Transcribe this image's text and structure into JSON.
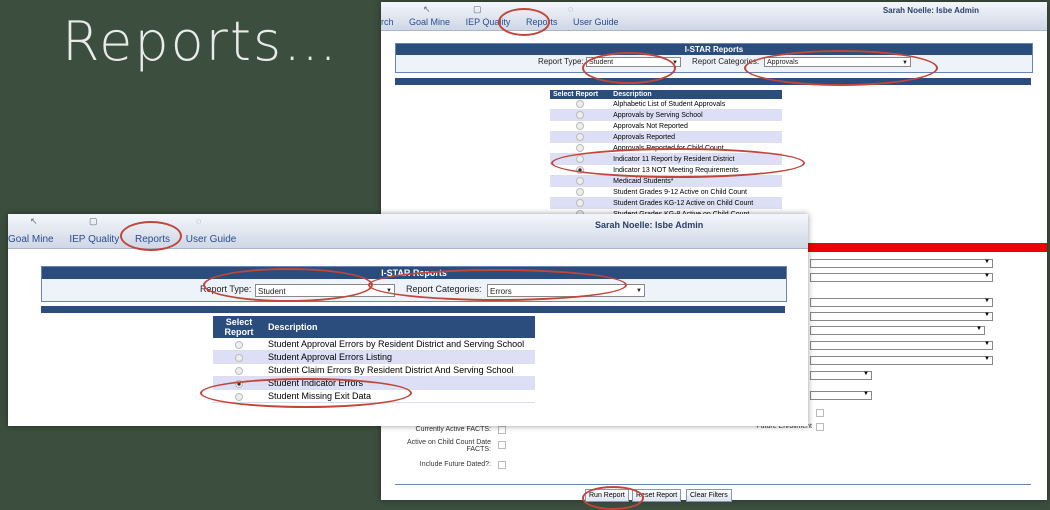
{
  "slide": {
    "title": "Reports…"
  },
  "back": {
    "nav": [
      "rch",
      "Goal Mine",
      "IEP Quality",
      "Reports",
      "User Guide"
    ],
    "user": "Sarah Noelle: Isbe Admin",
    "box_title": "I-STAR Reports",
    "report_type_label": "Report Type:",
    "report_type_value": "Student",
    "report_cat_label": "Report Categories:",
    "report_cat_value": "Approvals",
    "col_select": "Select Report",
    "col_desc": "Description",
    "rows": [
      "Alphabetic List of Student Approvals",
      "Approvals by Serving School",
      "Approvals Not Reported",
      "Approvals Reported",
      "Approvals Reported for Child Count",
      "Indicator 11 Report by Resident District",
      "Indicator 13 NOT Meeting Requirements",
      "Medicaid Students*",
      "Student Grades 9-12 Active on Child Count",
      "Student Grades KG-12 Active on Child Count",
      "Student Grades KG-8 Active on Child Count"
    ],
    "selected_row": 6,
    "filters": {
      "currently_active": "Currently Active FACTS:",
      "future_enrollment": "Future Enrollment",
      "active_child_count": "Active on Child Count Date FACTS:",
      "include_future": "Include Future Dated?:"
    },
    "buttons": [
      "Run Report",
      "Reset Report",
      "Clear Filters"
    ]
  },
  "front": {
    "nav": [
      "Goal Mine",
      "IEP Quality",
      "Reports",
      "User Guide"
    ],
    "user": "Sarah Noelle: Isbe Admin",
    "box_title": "I-STAR Reports",
    "report_type_label": "Report Type:",
    "report_type_value": "Student",
    "report_cat_label": "Report Categories:",
    "report_cat_value": "Errors",
    "col_select": "Select Report",
    "col_desc": "Description",
    "rows": [
      "Student Approval Errors by Resident District and Serving School",
      "Student Approval Errors Listing",
      "Student Claim Errors By Resident District And Serving School",
      "Student Indicator Errors",
      "Student Missing Exit Data"
    ],
    "selected_row": 3
  }
}
